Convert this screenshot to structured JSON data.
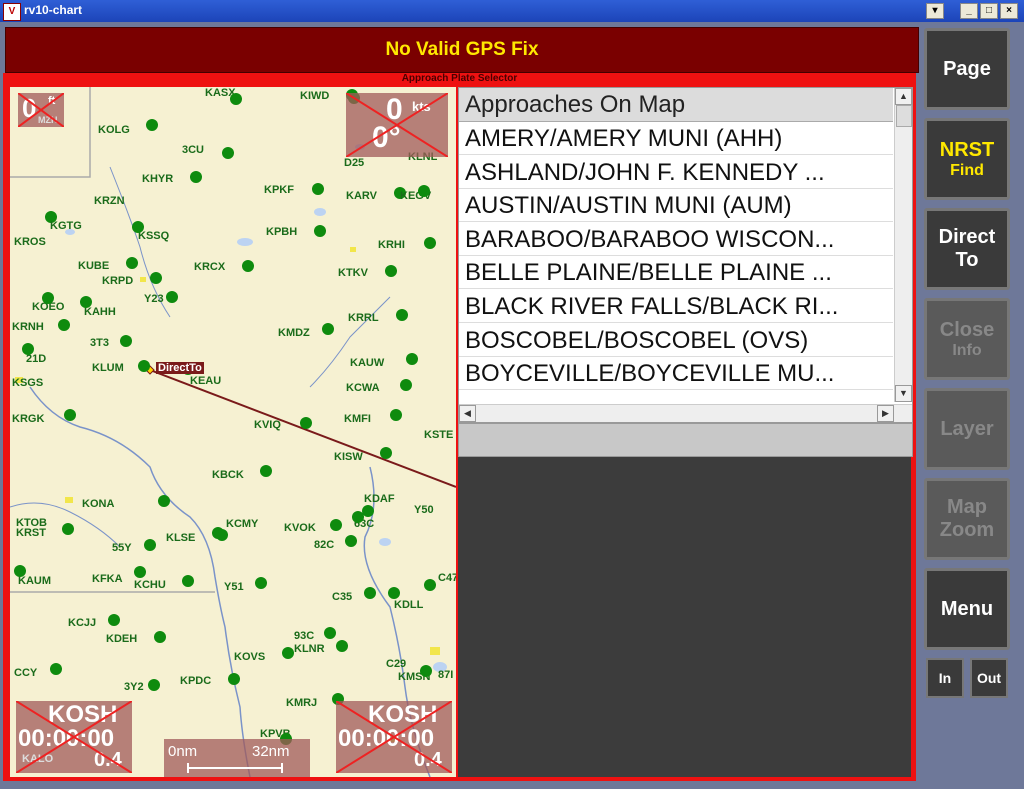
{
  "window": {
    "title": "rv10-chart",
    "icon_text": "V"
  },
  "banner": {
    "text": "No Valid GPS Fix"
  },
  "panel_label": "Approach Plate Selector",
  "map": {
    "hud_top_left": {
      "value": "0",
      "unit": "ft",
      "sub": "MZH"
    },
    "hud_top_right": {
      "speed": "0",
      "speed_unit": "kts",
      "heading": "0°"
    },
    "hud_bottom_left": {
      "ident": "KOSH",
      "time": "00:00:00",
      "dist": "0.4",
      "sub": "KALO"
    },
    "hud_bottom_right": {
      "ident": "KOSH",
      "time": "00:00:00",
      "dist": "0.4"
    },
    "scale": {
      "left": "0nm",
      "right": "32nm"
    },
    "direct_to_label": "DirectTo",
    "waypoints": [
      {
        "name": "KASX"
      },
      {
        "name": "KIWD"
      },
      {
        "name": "KOLG"
      },
      {
        "name": "3CU"
      },
      {
        "name": "KHYR"
      },
      {
        "name": "KPKF"
      },
      {
        "name": "KARV"
      },
      {
        "name": "KEGV"
      },
      {
        "name": "KRZN"
      },
      {
        "name": "KGTG"
      },
      {
        "name": "KROS"
      },
      {
        "name": "KSSQ"
      },
      {
        "name": "KPBH"
      },
      {
        "name": "KRHI"
      },
      {
        "name": "KUBE"
      },
      {
        "name": "KRPD"
      },
      {
        "name": "KRCX"
      },
      {
        "name": "KTKV"
      },
      {
        "name": "Y23"
      },
      {
        "name": "KOEO"
      },
      {
        "name": "KAHH"
      },
      {
        "name": "KRNH"
      },
      {
        "name": "KRRL"
      },
      {
        "name": "KMDZ"
      },
      {
        "name": "3T3"
      },
      {
        "name": "21D"
      },
      {
        "name": "KLUM"
      },
      {
        "name": "KEAU"
      },
      {
        "name": "KAUW"
      },
      {
        "name": "KSGS"
      },
      {
        "name": "KCWA"
      },
      {
        "name": "KRGK"
      },
      {
        "name": "KMFI"
      },
      {
        "name": "KVIQ"
      },
      {
        "name": "KSTE"
      },
      {
        "name": "KISW"
      },
      {
        "name": "KBCK"
      },
      {
        "name": "KONA"
      },
      {
        "name": "KDAF"
      },
      {
        "name": "Y50"
      },
      {
        "name": "KTOB"
      },
      {
        "name": "KRST"
      },
      {
        "name": "KCMY"
      },
      {
        "name": "KVOK"
      },
      {
        "name": "63C"
      },
      {
        "name": "55Y"
      },
      {
        "name": "KLSE"
      },
      {
        "name": "82C"
      },
      {
        "name": "KAUM"
      },
      {
        "name": "KFKA"
      },
      {
        "name": "KCHU"
      },
      {
        "name": "Y51"
      },
      {
        "name": "C35"
      },
      {
        "name": "C47"
      },
      {
        "name": "KDLL"
      },
      {
        "name": "KCJJ"
      },
      {
        "name": "KDEH"
      },
      {
        "name": "93C"
      },
      {
        "name": "KLNR"
      },
      {
        "name": "KOVS"
      },
      {
        "name": "CCY"
      },
      {
        "name": "C29"
      },
      {
        "name": "KMSN"
      },
      {
        "name": "3Y2"
      },
      {
        "name": "KPDC"
      },
      {
        "name": "KMRJ"
      },
      {
        "name": "KPVB"
      },
      {
        "name": "D25"
      },
      {
        "name": "KLNL"
      },
      {
        "name": "87I"
      }
    ]
  },
  "approach_list": {
    "header": "Approaches On Map",
    "items": [
      "AMERY/AMERY MUNI (AHH)",
      "ASHLAND/JOHN F. KENNEDY ...",
      "AUSTIN/AUSTIN MUNI (AUM)",
      "BARABOO/BARABOO WISCON...",
      "BELLE PLAINE/BELLE PLAINE ...",
      "BLACK RIVER FALLS/BLACK RI...",
      "BOSCOBEL/BOSCOBEL (OVS)",
      "BOYCEVILLE/BOYCEVILLE MU..."
    ]
  },
  "sidebar": {
    "page": "Page",
    "nrst": "NRST",
    "nrst_sub": "Find",
    "direct": "Direct",
    "direct_sub": "To",
    "close": "Close",
    "close_sub": "Info",
    "layer": "Layer",
    "map_zoom": "Map",
    "map_zoom_sub": "Zoom",
    "menu": "Menu",
    "zoom_in": "In",
    "zoom_out": "Out"
  },
  "colors": {
    "banner_bg": "#7a0000",
    "banner_text": "#ffe800",
    "frame_red": "#ee1111",
    "waypoint_green": "#0e8b0e",
    "nrst_yellow": "#ffe800"
  }
}
